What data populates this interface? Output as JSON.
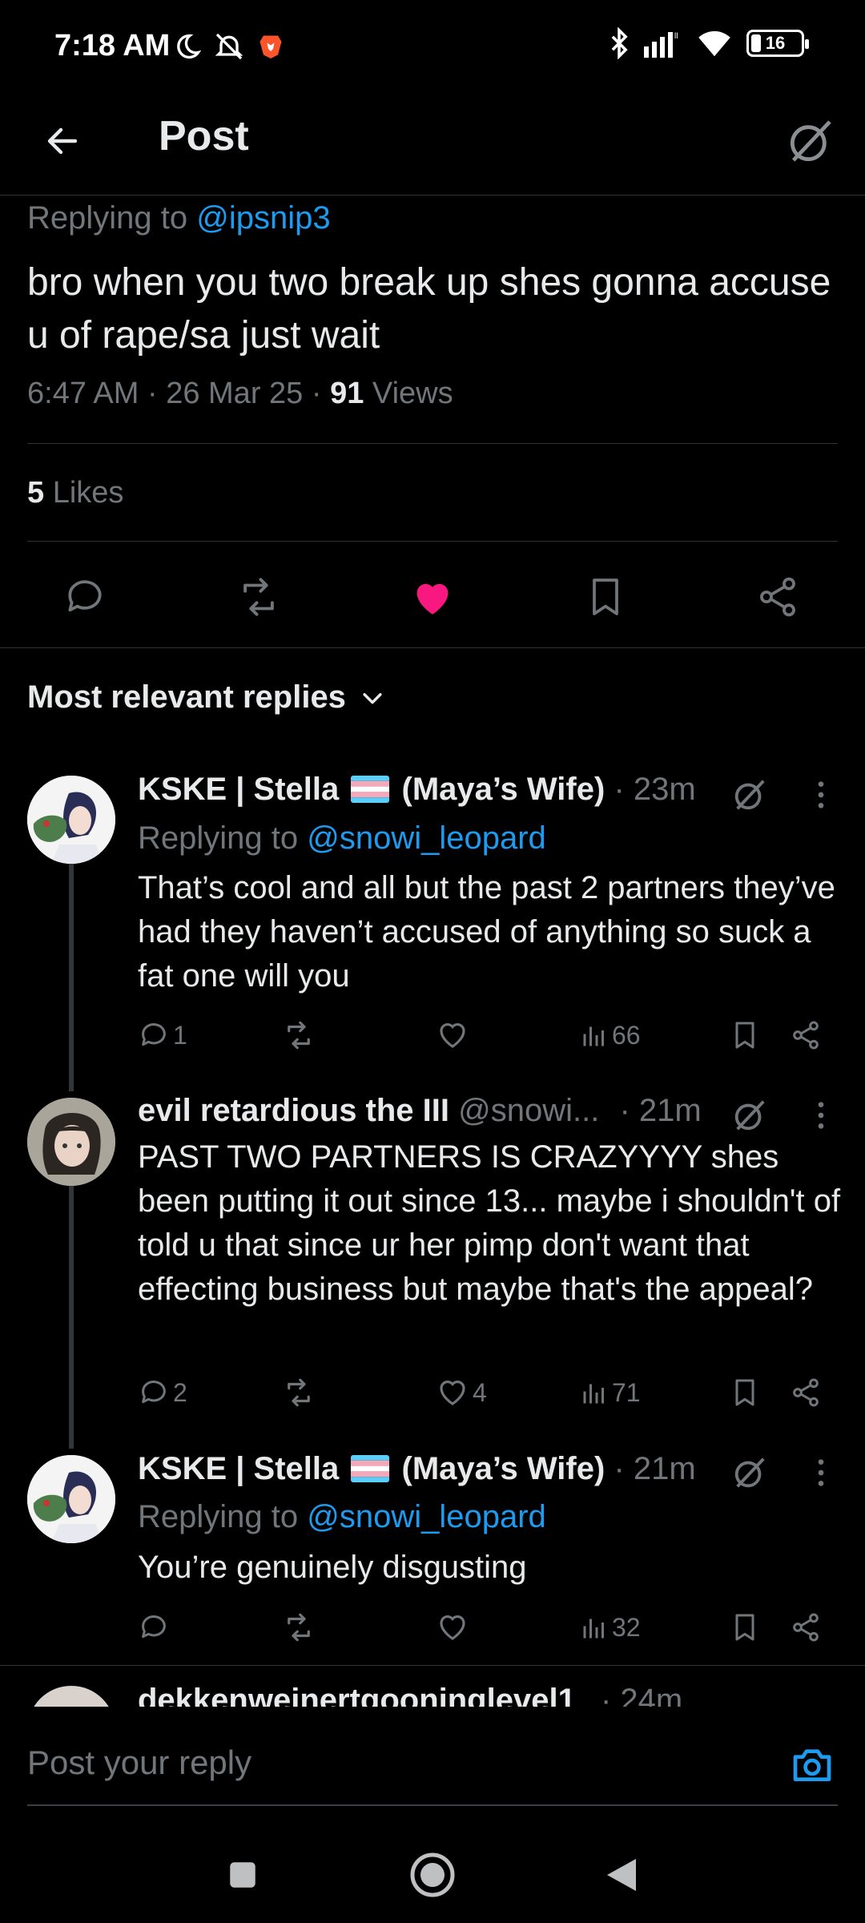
{
  "status_bar": {
    "time": "7:18 AM",
    "battery": "16"
  },
  "header": {
    "title": "Post"
  },
  "post": {
    "replying_prefix": "Replying to",
    "replying_handle": "@ipsnip3",
    "text": "bro when you two break up shes gonna accuse u of rape/sa just wait",
    "time": "6:47 AM",
    "date": "26 Mar 25",
    "views_count": "91",
    "views_label": "Views",
    "likes_count": "5",
    "likes_label": "Likes"
  },
  "replies_section": {
    "sort_label": "Most relevant replies"
  },
  "replies": [
    {
      "name": "KSKE | Stella",
      "name_suffix": "(Maya’s Wife)",
      "time": "· 23m",
      "replying_prefix": "Replying to",
      "replying_handle": "@snowi_leopard",
      "text": "That’s cool and all but the past 2 partners they’ve had they haven’t accused of anything so suck a fat one will you",
      "replies": "1",
      "reposts": "",
      "likes": "",
      "views": "66"
    },
    {
      "name": "evil retardious the III",
      "handle": "@snowi...",
      "time": "· 21m",
      "text": "PAST TWO PARTNERS IS CRAZYYYY shes been putting it out since 13... maybe i shouldn't of told u that since ur her pimp don't want that effecting business but maybe that's the appeal?",
      "replies": "2",
      "reposts": "",
      "likes": "4",
      "views": "71"
    },
    {
      "name": "KSKE | Stella",
      "name_suffix": "(Maya’s Wife)",
      "time": "· 21m",
      "replying_prefix": "Replying to",
      "replying_handle": "@snowi_leopard",
      "text": "You’re genuinely disgusting",
      "replies": "",
      "reposts": "",
      "likes": "",
      "views": "32"
    },
    {
      "name": "dekkenweinertgooninglevel1",
      "time": "· 24m"
    }
  ],
  "composer": {
    "placeholder": "Post your reply"
  },
  "colors": {
    "background": "#000000",
    "accent": "#1d9bf0",
    "like": "#f91880",
    "muted": "#71767b"
  }
}
